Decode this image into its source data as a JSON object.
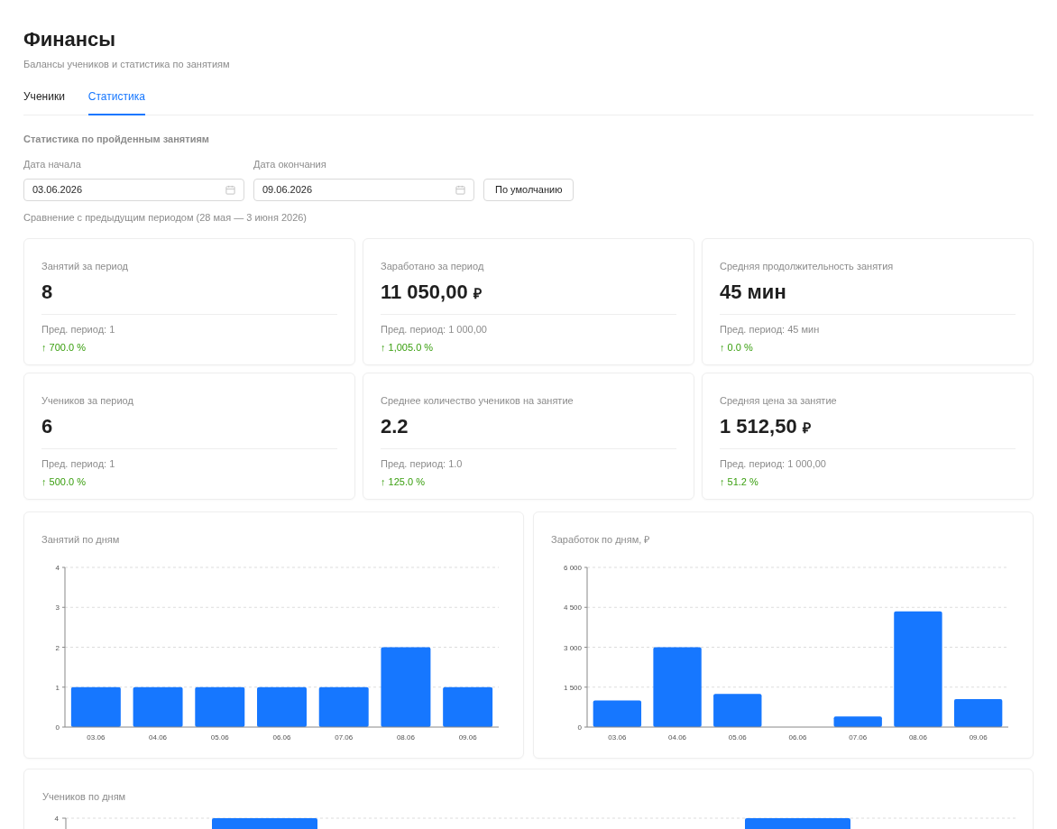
{
  "header": {
    "title": "Финансы",
    "subtitle": "Балансы учеников и статистика по занятиям"
  },
  "tabs": [
    {
      "label": "Ученики",
      "selected": false
    },
    {
      "label": "Статистика",
      "selected": true
    }
  ],
  "section_title": "Статистика по пройденным занятиям",
  "date_fields": [
    {
      "label": "Дата начала",
      "value": "03.06.2026"
    },
    {
      "label": "Дата окончания",
      "value": "09.06.2026"
    }
  ],
  "reset_button": "По умолчанию",
  "comparison_note": "Сравнение с предыдущим периодом (28 мая — 3 июня 2026)",
  "metrics": [
    {
      "label": "Занятий за период",
      "value": "8",
      "previous": "Пред. период: 1",
      "change": "↑ 700.0 %"
    },
    {
      "label": "Заработано за период",
      "value": "11 050,00",
      "unit": "₽",
      "previous": "Пред. период: 1 000,00",
      "change": "↑ 1,005.0 %"
    },
    {
      "label": "Средняя продолжительность занятия",
      "value": "45 мин",
      "previous": "Пред. период: 45 мин",
      "change": "↑ 0.0 %"
    },
    {
      "label": "Учеников за период",
      "value": "6",
      "previous": "Пред. период: 1",
      "change": "↑ 500.0 %"
    },
    {
      "label": "Среднее количество учеников на занятие",
      "value": "2.2",
      "previous": "Пред. период: 1.0",
      "change": "↑ 125.0 %"
    },
    {
      "label": "Средняя цена за занятие",
      "value": "1 512,50",
      "unit": "₽",
      "previous": "Пред. период: 1 000,00",
      "change": "↑ 51.2 %"
    }
  ],
  "charts": [
    {
      "title": "Занятий по дням",
      "chart_data": {
        "type": "bar",
        "categories": [
          "03.06",
          "04.06",
          "05.06",
          "06.06",
          "07.06",
          "08.06",
          "09.06"
        ],
        "series": [
          {
            "color": "#1677ff",
            "values": [
              1,
              1,
              1,
              1,
              1,
              2,
              1
            ]
          }
        ],
        "grid": true,
        "ylim": [
          0,
          4
        ],
        "yticks": [
          0,
          1,
          2,
          3,
          4
        ]
      }
    },
    {
      "title": "Заработок по дням, ₽",
      "chart_data": {
        "type": "bar",
        "categories": [
          "03.06",
          "04.06",
          "05.06",
          "06.06",
          "07.06",
          "08.06",
          "09.06"
        ],
        "series": [
          {
            "color": "#1677ff",
            "values": [
              1000,
              3000,
              1250,
              0,
              400,
              4350,
              1050
            ]
          }
        ],
        "grid": true,
        "ylim": [
          0,
          6000
        ],
        "yticks": [
          {
            "value": 0,
            "label": "0"
          },
          {
            "value": 1500,
            "label": "1 500"
          },
          {
            "value": 3000,
            "label": "3 000"
          },
          {
            "value": 4500,
            "label": "4 500"
          },
          {
            "value": 6000,
            "label": "6 000"
          }
        ]
      }
    }
  ],
  "students_chart": {
    "title": "Учеников по дням",
    "visible_tick": "4"
  }
}
